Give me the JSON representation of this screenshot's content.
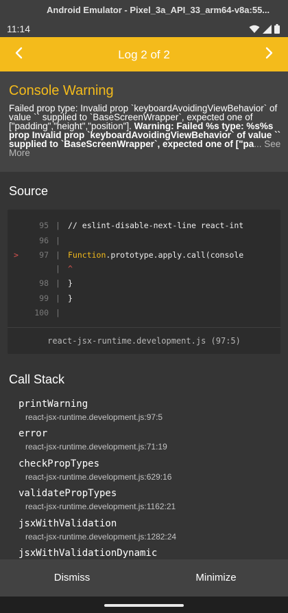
{
  "window": {
    "title": "Android Emulator - Pixel_3a_API_33_arm64-v8a:55..."
  },
  "statusbar": {
    "time": "11:14",
    "icons": [
      "wifi-icon",
      "signal-icon",
      "battery-icon"
    ]
  },
  "header": {
    "title": "Log 2 of 2",
    "prev_icon": "chevron-left-icon",
    "next_icon": "chevron-right-icon",
    "color": "#f4bb1b"
  },
  "warning": {
    "title": "Console Warning",
    "message_plain": "Failed prop type: Invalid prop `keyboardAvoidingViewBehavior` of value `` supplied to `BaseScreenWrapper`, expected one of [\"padding\",\"height\",\"position\"].",
    "message_bold": " Warning: Failed %s type: %s%s prop Invalid prop `keyboardAvoidingViewBehavior` of value `` supplied to `BaseScreenWrapper`, expected one of [\"pa",
    "see_more": "... See More"
  },
  "source": {
    "title": "Source",
    "lines": [
      {
        "num": "95",
        "marker": "",
        "code": "    // eslint-disable-next-line react-int"
      },
      {
        "num": "96",
        "marker": "",
        "code": ""
      },
      {
        "num": "97",
        "marker": ">",
        "code_fn": "    Function",
        "code_rest": ".prototype.apply.call(console"
      },
      {
        "num": "",
        "marker": "",
        "caret": "    ^"
      },
      {
        "num": "98",
        "marker": "",
        "code": "  }"
      },
      {
        "num": "99",
        "marker": "",
        "code": "}"
      },
      {
        "num": "100",
        "marker": "",
        "code": ""
      }
    ],
    "location": "react-jsx-runtime.development.js (97:5)"
  },
  "callstack": {
    "title": "Call Stack",
    "frames": [
      {
        "name": "printWarning",
        "location": "react-jsx-runtime.development.js:97:5"
      },
      {
        "name": "error",
        "location": "react-jsx-runtime.development.js:71:19"
      },
      {
        "name": "checkPropTypes",
        "location": "react-jsx-runtime.development.js:629:16"
      },
      {
        "name": "validatePropTypes",
        "location": "react-jsx-runtime.development.js:1162:21"
      },
      {
        "name": "jsxWithValidation",
        "location": "react-jsx-runtime.development.js:1282:24"
      },
      {
        "name": "jsxWithValidationDynamic",
        "location": ""
      }
    ]
  },
  "footer": {
    "dismiss": "Dismiss",
    "minimize": "Minimize"
  }
}
